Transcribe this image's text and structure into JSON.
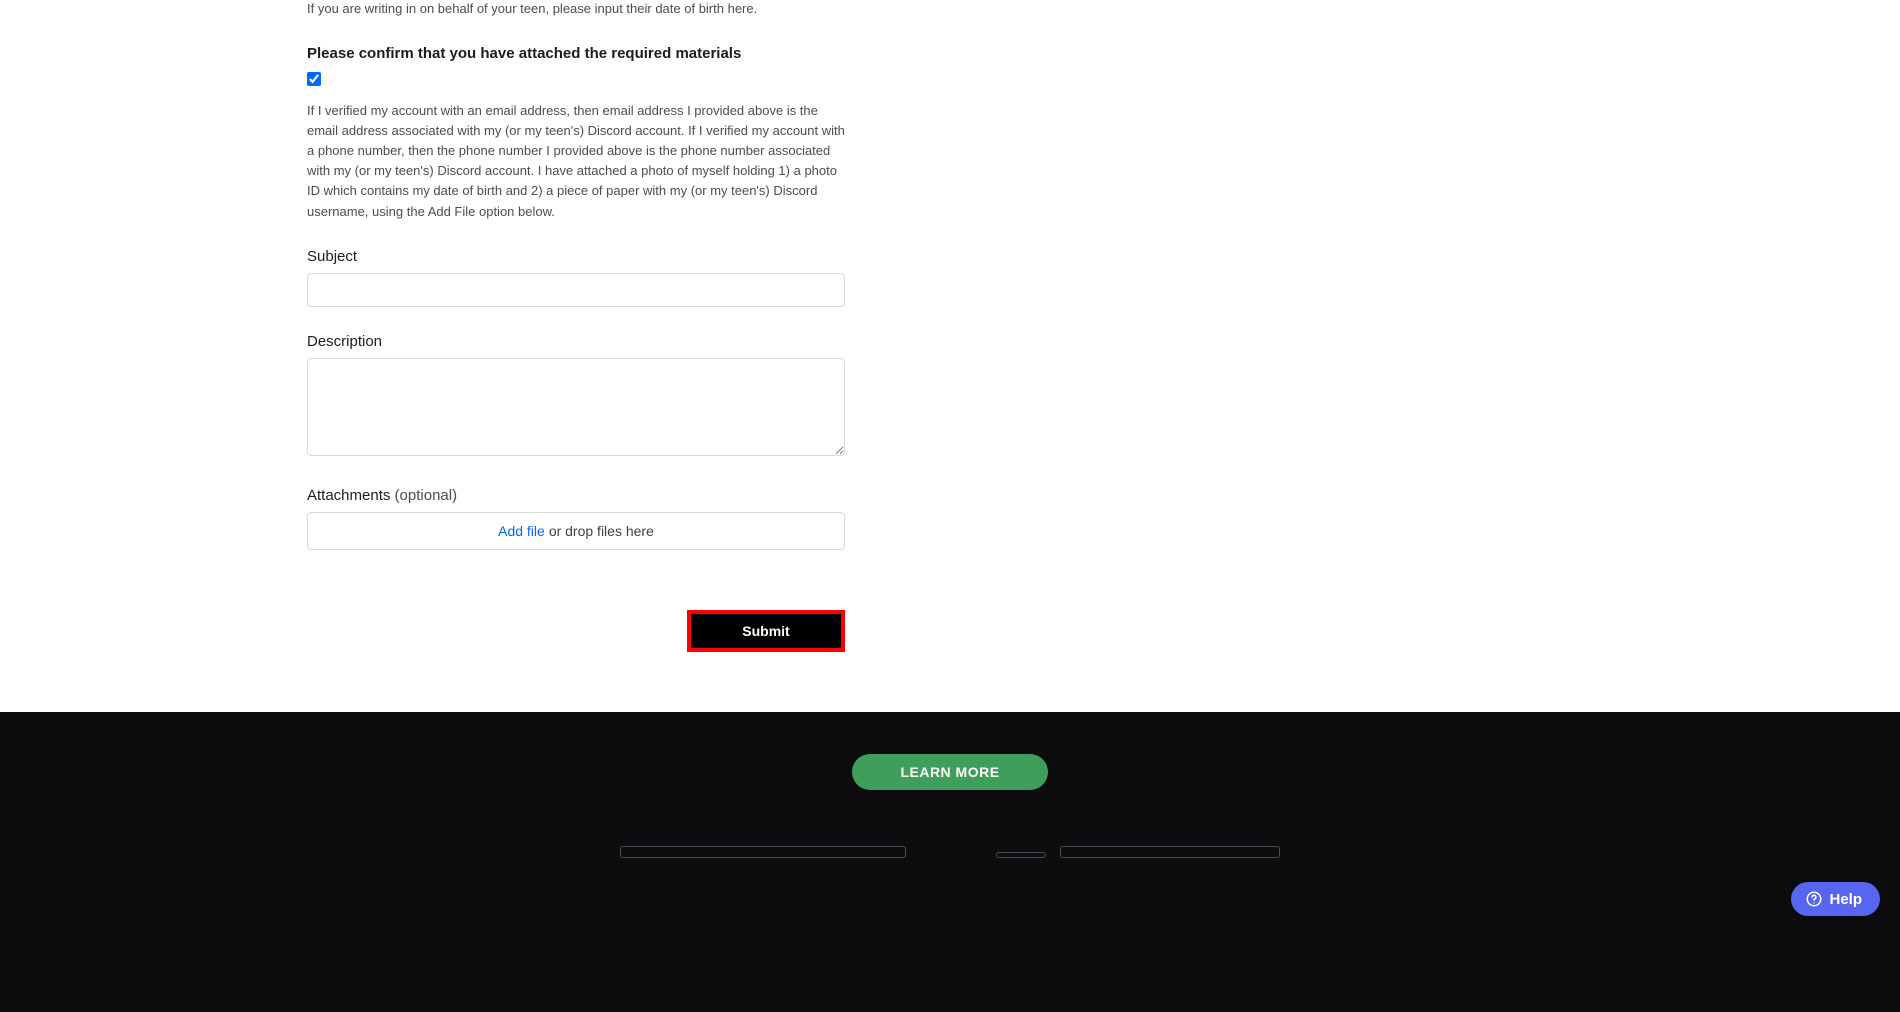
{
  "form": {
    "teen_hint": "If you are writing in on behalf of your teen, please input their date of birth here.",
    "confirm_heading": "Please confirm that you have attached the required materials",
    "confirm_checked": true,
    "consent_text": "If I verified my account with an email address, then email address I provided above is the email address associated with my (or my teen's) Discord account. If I verified my account with a phone number, then the phone number I provided above is the phone number associated with my (or my teen's) Discord account. I have attached a photo of myself holding 1) a photo ID which contains my date of birth and 2) a piece of paper with my (or my teen's) Discord username, using the Add File option below.",
    "subject_label": "Subject",
    "subject_value": "",
    "description_label": "Description",
    "description_value": "",
    "attachments_label": "Attachments",
    "attachments_optional": "(optional)",
    "add_file_label": "Add file",
    "drop_hint": "or drop files here",
    "submit_label": "Submit"
  },
  "footer": {
    "learn_more": "LEARN MORE"
  },
  "help": {
    "label": "Help"
  }
}
